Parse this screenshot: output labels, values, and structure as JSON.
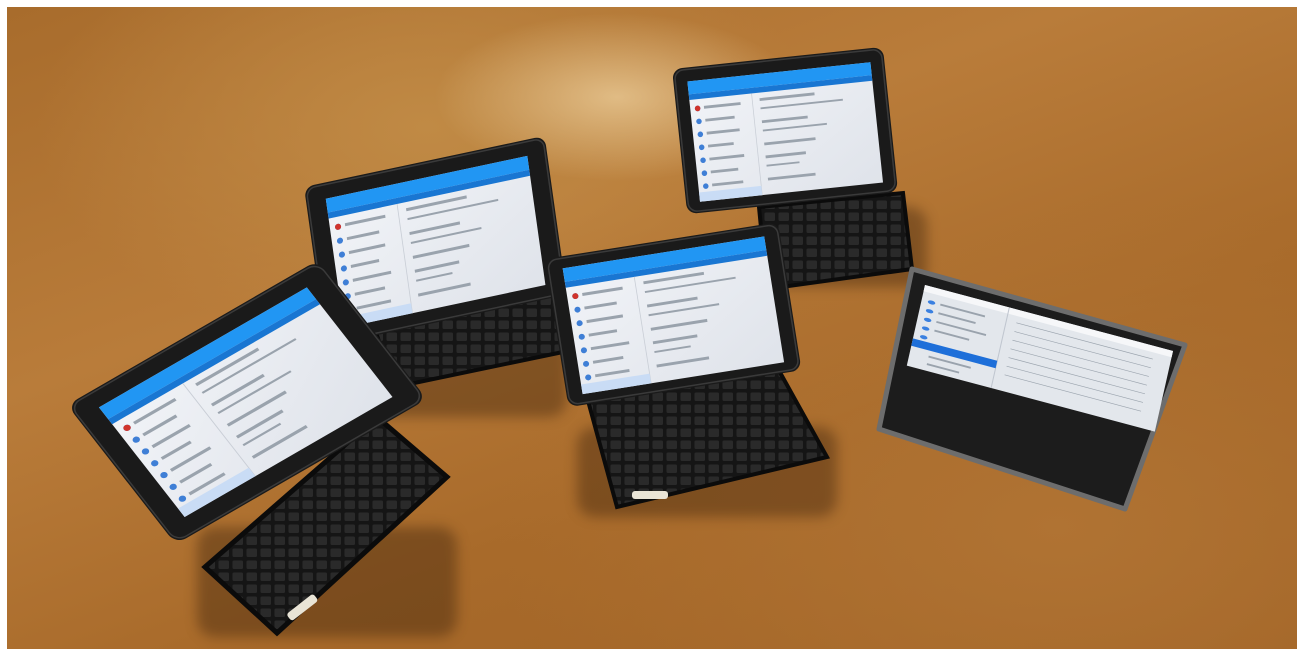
{
  "scene": {
    "surface": "wooden-floor",
    "floor_color": "#b07636",
    "device_count": 5
  },
  "devices": [
    {
      "kind": "tablet-with-keyboard",
      "screen_theme": "settings-list",
      "accent": "#2196f3"
    },
    {
      "kind": "tablet-with-keyboard",
      "screen_theme": "settings-list",
      "accent": "#2196f3"
    },
    {
      "kind": "tablet-with-keyboard",
      "screen_theme": "settings-list",
      "accent": "#2196f3"
    },
    {
      "kind": "tablet-with-keyboard",
      "screen_theme": "settings-list",
      "accent": "#2196f3"
    },
    {
      "kind": "tablet",
      "screen_theme": "settings-list",
      "accent": "#1e6fd9"
    }
  ]
}
